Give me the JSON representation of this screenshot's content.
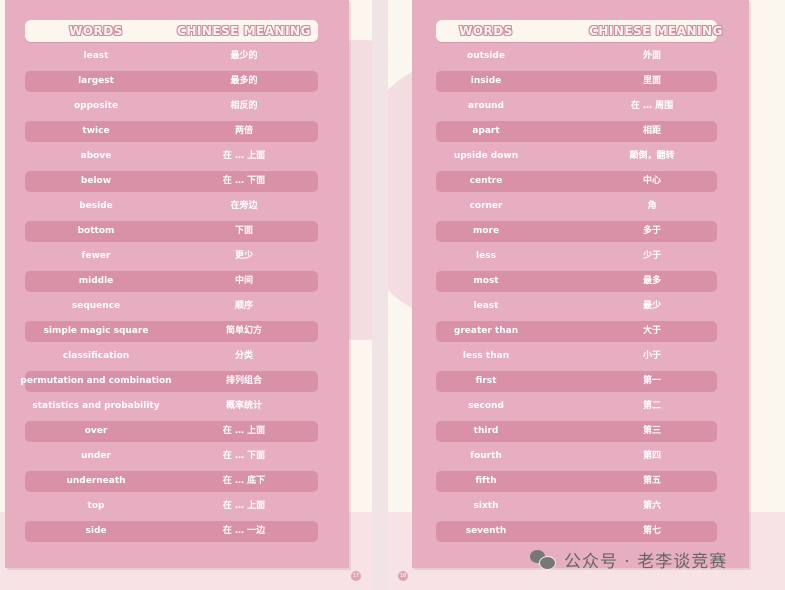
{
  "left_page": {
    "header": {
      "words": "WORDS",
      "meaning": "CHINESE MEANING"
    },
    "rows": [
      {
        "word": "least",
        "meaning": "最少的"
      },
      {
        "word": "largest",
        "meaning": "最多的"
      },
      {
        "word": "opposite",
        "meaning": "相反的"
      },
      {
        "word": "twice",
        "meaning": "两倍"
      },
      {
        "word": "above",
        "meaning": "在 … 上面"
      },
      {
        "word": "below",
        "meaning": "在 … 下面"
      },
      {
        "word": "beside",
        "meaning": "在旁边"
      },
      {
        "word": "bottom",
        "meaning": "下面"
      },
      {
        "word": "fewer",
        "meaning": "更少"
      },
      {
        "word": "middle",
        "meaning": "中间"
      },
      {
        "word": "sequence",
        "meaning": "顺序"
      },
      {
        "word": "simple magic square",
        "meaning": "简单幻方"
      },
      {
        "word": "classification",
        "meaning": "分类"
      },
      {
        "word": "permutation and combination",
        "meaning": "排列组合"
      },
      {
        "word": "statistics and probability",
        "meaning": "概率统计"
      },
      {
        "word": "over",
        "meaning": "在 … 上面"
      },
      {
        "word": "under",
        "meaning": "在 … 下面"
      },
      {
        "word": "underneath",
        "meaning": "在 … 底下"
      },
      {
        "word": "top",
        "meaning": "在 … 上面"
      },
      {
        "word": "side",
        "meaning": "在 … 一边"
      }
    ],
    "page_number": "17"
  },
  "right_page": {
    "header": {
      "words": "WORDS",
      "meaning": "CHINESE MEANING"
    },
    "rows": [
      {
        "word": "outside",
        "meaning": "外面"
      },
      {
        "word": "inside",
        "meaning": "里面"
      },
      {
        "word": "around",
        "meaning": "在 … 周围"
      },
      {
        "word": "apart",
        "meaning": "相距"
      },
      {
        "word": "upside down",
        "meaning": "颠倒，翻转"
      },
      {
        "word": "centre",
        "meaning": "中心"
      },
      {
        "word": "corner",
        "meaning": "角"
      },
      {
        "word": "more",
        "meaning": "多于"
      },
      {
        "word": "less",
        "meaning": "少于"
      },
      {
        "word": "most",
        "meaning": "最多"
      },
      {
        "word": "least",
        "meaning": "最少"
      },
      {
        "word": "greater than",
        "meaning": "大于"
      },
      {
        "word": "less than",
        "meaning": "小于"
      },
      {
        "word": "first",
        "meaning": "第一"
      },
      {
        "word": "second",
        "meaning": "第二"
      },
      {
        "word": "third",
        "meaning": "第三"
      },
      {
        "word": "fourth",
        "meaning": "第四"
      },
      {
        "word": "fifth",
        "meaning": "第五"
      },
      {
        "word": "sixth",
        "meaning": "第六"
      },
      {
        "word": "seventh",
        "meaning": "第七"
      }
    ],
    "page_number": "18"
  },
  "watermark": {
    "text": "公众号 · 老李谈竞赛",
    "icon": "wechat-icon"
  },
  "colors": {
    "card": "#e6aec0",
    "row_bar": "#d991a7",
    "header_bg": "#fdf6ee",
    "header_outline": "#cf8ba2",
    "page_bg": "#fbf7ee"
  }
}
